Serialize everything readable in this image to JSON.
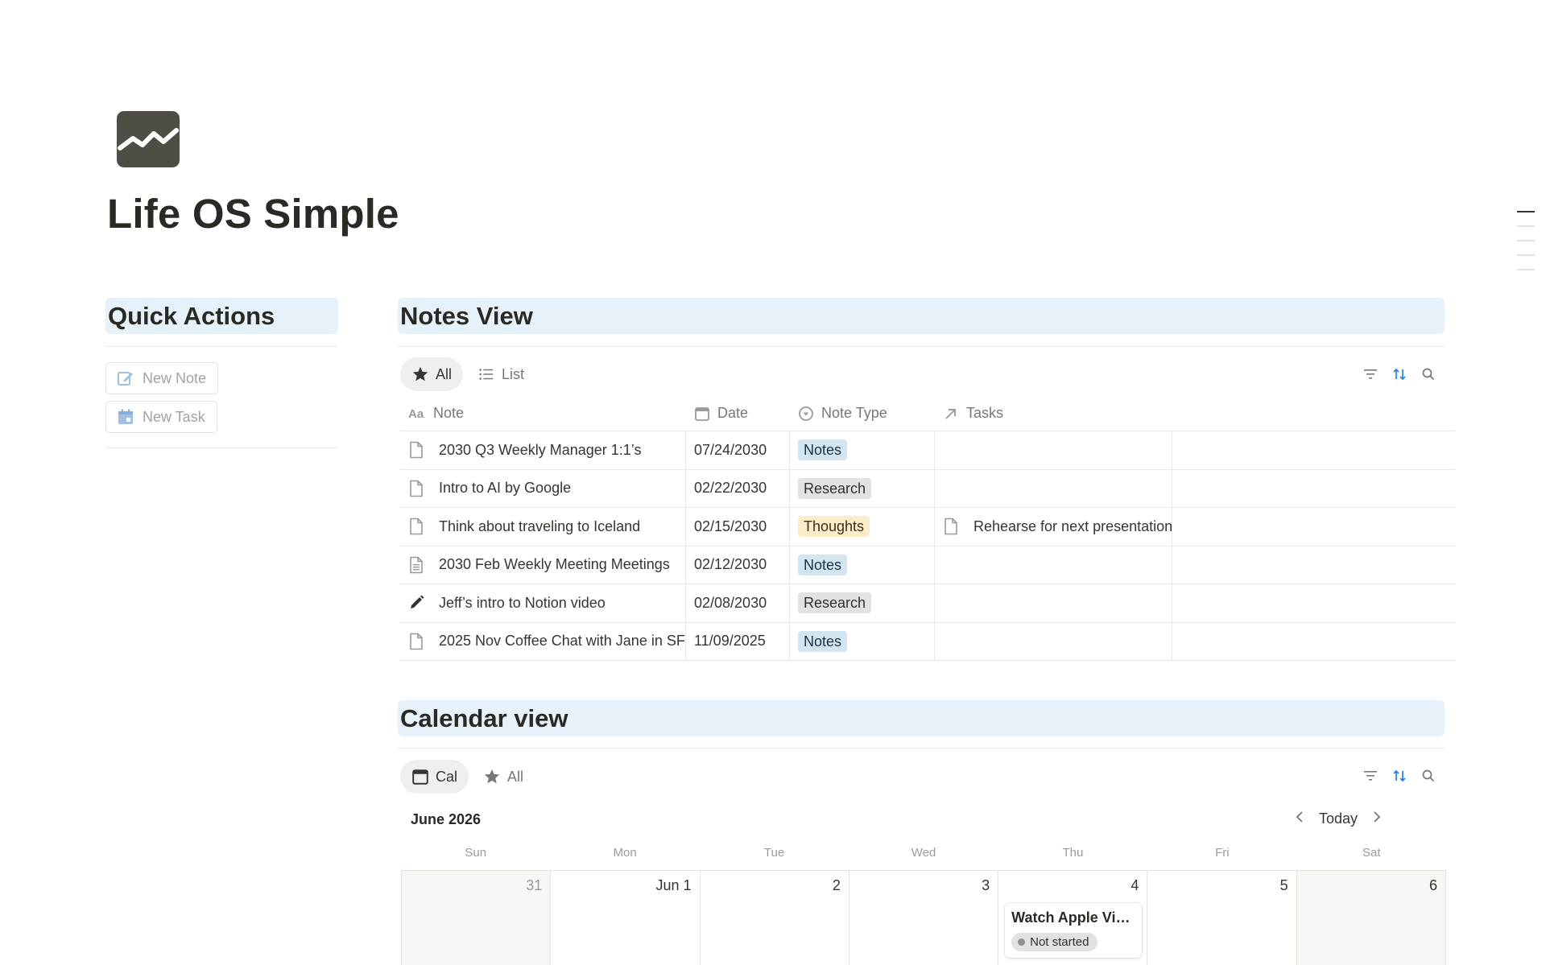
{
  "page": {
    "title": "Life OS Simple",
    "icon": "chart-line-icon"
  },
  "quick_actions": {
    "heading": "Quick Actions",
    "buttons": [
      {
        "label": "New Note",
        "icon": "edit-note-icon"
      },
      {
        "label": "New Task",
        "icon": "calendar-task-icon"
      }
    ]
  },
  "notes_view": {
    "heading": "Notes View",
    "tabs": [
      {
        "label": "All",
        "icon": "star-icon",
        "active": true
      },
      {
        "label": "List",
        "icon": "list-icon",
        "active": false
      }
    ],
    "columns": [
      {
        "label": "Note",
        "icon": "text-property-icon"
      },
      {
        "label": "Date",
        "icon": "calendar-property-icon"
      },
      {
        "label": "Note Type",
        "icon": "select-property-icon"
      },
      {
        "label": "Tasks",
        "icon": "relation-arrow-icon"
      }
    ],
    "rows": [
      {
        "note": "2030 Q3 Weekly Manager 1:1’s",
        "icon": "page-icon",
        "date": "07/24/2030",
        "type": "Notes",
        "tasks": ""
      },
      {
        "note": "Intro to AI by Google",
        "icon": "page-icon",
        "date": "02/22/2030",
        "type": "Research",
        "tasks": ""
      },
      {
        "note": "Think about traveling to Iceland",
        "icon": "page-icon",
        "date": "02/15/2030",
        "type": "Thoughts",
        "tasks": "Rehearse for next presentation"
      },
      {
        "note": "2030 Feb Weekly Meeting Meetings",
        "icon": "page-lines-icon",
        "date": "02/12/2030",
        "type": "Notes",
        "tasks": ""
      },
      {
        "note": "Jeff’s intro to Notion video",
        "icon": "pencil-icon",
        "date": "02/08/2030",
        "type": "Research",
        "tasks": ""
      },
      {
        "note": "2025 Nov Coffee Chat with Jane in SF",
        "icon": "page-icon",
        "date": "11/09/2025",
        "type": "Notes",
        "tasks": ""
      }
    ],
    "tag_colors": {
      "Notes": {
        "bg": "#d3e5ef",
        "fg": "#183347"
      },
      "Research": {
        "bg": "#e3e2e0",
        "fg": "#32302c"
      },
      "Thoughts": {
        "bg": "#fdecc8",
        "fg": "#402c1b"
      }
    }
  },
  "calendar_view": {
    "heading": "Calendar view",
    "tabs": [
      {
        "label": "Cal",
        "icon": "calendar-icon",
        "active": true
      },
      {
        "label": "All",
        "icon": "star-icon",
        "active": false
      }
    ],
    "month": "June 2026",
    "today_label": "Today",
    "weekdays": [
      "Sun",
      "Mon",
      "Tue",
      "Wed",
      "Thu",
      "Fri",
      "Sat"
    ],
    "days": [
      {
        "num": "31",
        "muted": true
      },
      {
        "num": "Jun 1",
        "muted": false
      },
      {
        "num": "2",
        "muted": false
      },
      {
        "num": "3",
        "muted": false
      },
      {
        "num": "4",
        "muted": false
      },
      {
        "num": "5",
        "muted": false
      },
      {
        "num": "6",
        "muted": false
      }
    ],
    "event": {
      "title": "Watch Apple Vi…",
      "status": "Not started"
    }
  },
  "colors": {
    "heading_bg": "#e7f1f9",
    "accent_blue": "#2383e2",
    "text": "#37352f"
  }
}
